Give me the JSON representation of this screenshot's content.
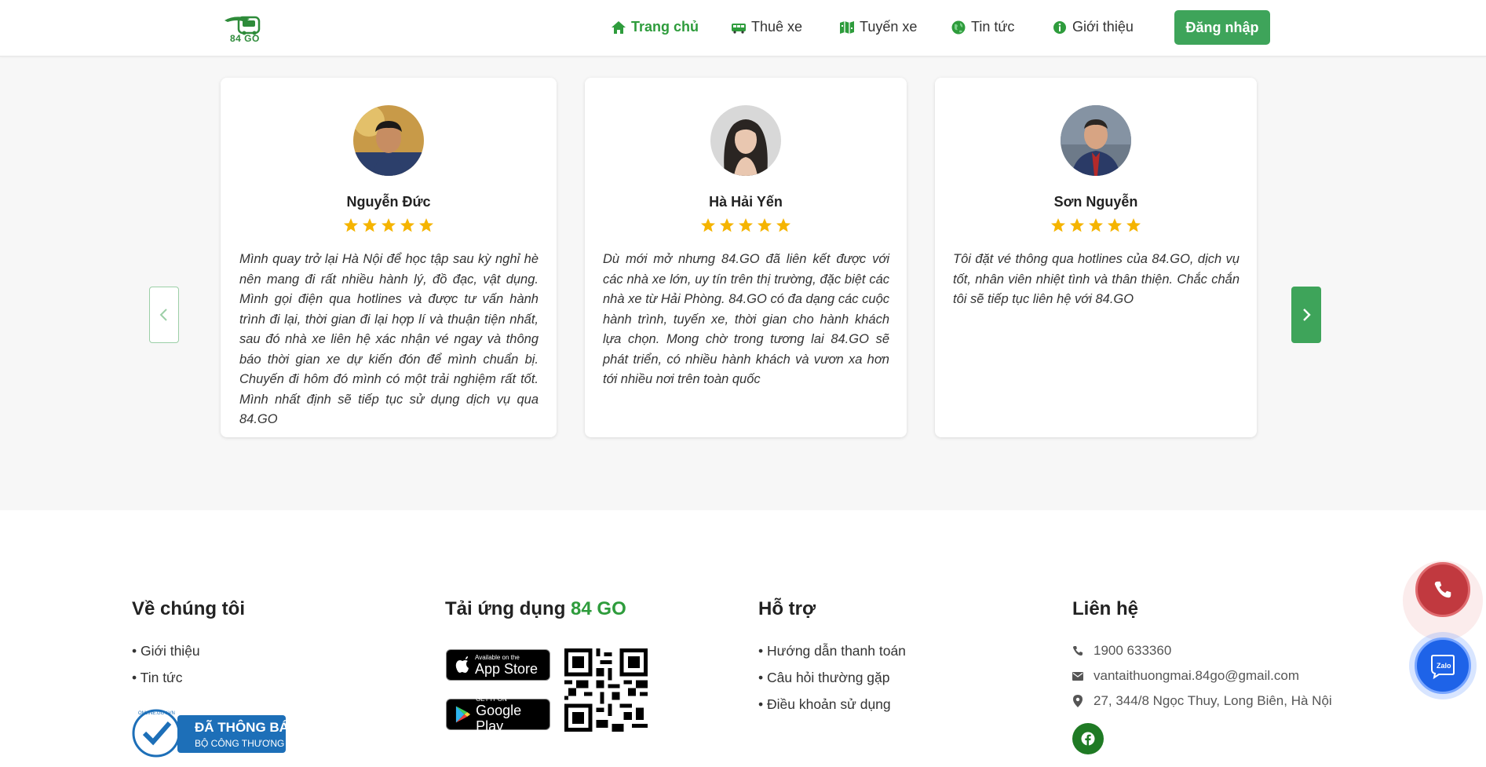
{
  "header": {
    "logo_text": "84 GO",
    "nav": [
      {
        "label": "Trang chủ",
        "icon": "home-icon"
      },
      {
        "label": "Thuê xe",
        "icon": "bus-icon"
      },
      {
        "label": "Tuyến xe",
        "icon": "map-icon"
      },
      {
        "label": "Tin tức",
        "icon": "globe-icon"
      },
      {
        "label": "Giới thiệu",
        "icon": "info-icon"
      }
    ],
    "login_label": "Đăng nhập"
  },
  "testimonials": [
    {
      "name": "Nguyễn Đức",
      "rating": 5,
      "quote": "Mình quay trở lại Hà Nội để học tập sau kỳ nghỉ hè nên mang đi rất nhiều hành lý, đồ đạc, vật dụng. Mình gọi điện qua hotlines và được tư vấn hành trình đi lại, thời gian đi lại hợp lí và thuận tiện nhất, sau đó nhà xe liên hệ xác nhận vé ngay và thông báo thời gian xe dự kiến đón để mình chuẩn bị. Chuyến đi hôm đó mình có một trải nghiệm rất tốt. Mình nhất định sẽ tiếp tục sử dụng dịch vụ qua 84.GO"
    },
    {
      "name": "Hà Hải Yến",
      "rating": 5,
      "quote": "Dù mới mở nhưng 84.GO đã liên kết được với các nhà xe lớn, uy tín trên thị trường, đặc biệt các nhà xe từ Hải Phòng. 84.GO có đa dạng các cuộc hành trình, tuyến xe, thời gian cho hành khách lựa chọn. Mong chờ trong tương lai 84.GO sẽ phát triển, có nhiều hành khách và vươn xa hơn tới nhiều nơi trên toàn quốc"
    },
    {
      "name": "Sơn Nguyễn",
      "rating": 5,
      "quote": "Tôi đặt vé thông qua hotlines của 84.GO, dịch vụ tốt, nhân viên nhiệt tình và thân thiện. Chắc chắn tôi sẽ tiếp tục liên hệ với 84.GO"
    }
  ],
  "footer": {
    "about": {
      "title": "Về chúng tôi",
      "links": [
        "• Giới thiệu",
        "• Tin tức"
      ],
      "badge_line1": "ĐÃ THÔNG BÁO",
      "badge_line2": "BỘ CÔNG THƯƠNG",
      "badge_ring": "ONLINE.GOV.VN"
    },
    "app": {
      "title_prefix": "Tải ứng dụng ",
      "title_highlight": "84 GO",
      "appstore_small": "Available on the",
      "appstore_big": "App Store",
      "googleplay_small": "GET IT ON",
      "googleplay_big": "Google Play"
    },
    "support": {
      "title": "Hỗ trợ",
      "links": [
        "• Hướng dẫn thanh toán",
        "• Câu hỏi thường gặp",
        "• Điều khoản sử dụng"
      ]
    },
    "contact": {
      "title": "Liên hệ",
      "phone": "1900 633360",
      "email": "vantaithuongmai.84go@gmail.com",
      "address": "27, 344/8 Ngọc Thuy, Long Biên, Hà Nội"
    }
  },
  "floating": {
    "zalo_label": "Zalo"
  },
  "colors": {
    "brand_green": "#3ea45a",
    "star": "#f5b400",
    "phone_red": "#c1393f",
    "zalo_blue": "#1e63e8"
  }
}
